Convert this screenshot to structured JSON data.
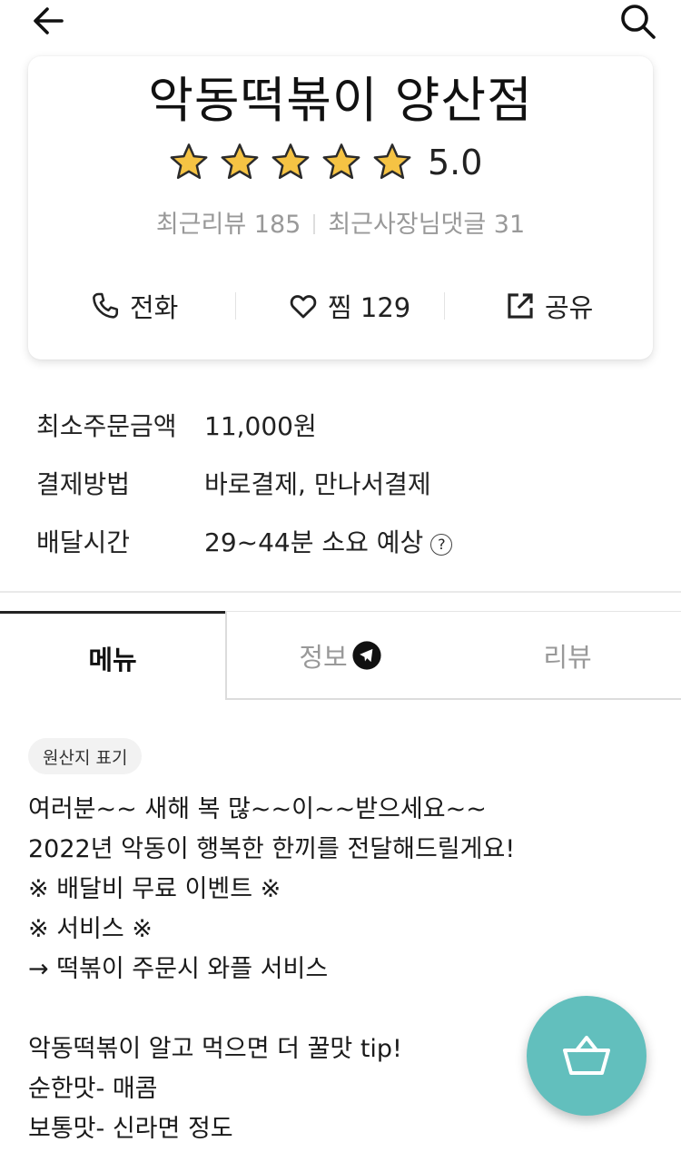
{
  "header": {
    "back_icon": "arrow-left-icon",
    "search_icon": "search-icon"
  },
  "store": {
    "name": "악동떡볶이 양산점",
    "rating": "5.0",
    "stars_filled": 5,
    "stars_total": 5,
    "star_color": "#f5c344",
    "recent_reviews_label": "최근리뷰 185",
    "recent_owner_replies_label": "최근사장님댓글 31"
  },
  "actions": {
    "call": {
      "label": "전화",
      "icon": "phone-icon"
    },
    "like": {
      "label": "찜 129",
      "icon": "heart-icon"
    },
    "share": {
      "label": "공유",
      "icon": "share-icon"
    }
  },
  "info": {
    "rows": [
      {
        "label": "최소주문금액",
        "value": "11,000원"
      },
      {
        "label": "결제방법",
        "value": "바로결제, 만나서결제"
      },
      {
        "label": "배달시간",
        "value": "29~44분 소요 예상"
      }
    ],
    "help_icon_text": "?"
  },
  "tabs": [
    {
      "label": "메뉴",
      "active": true
    },
    {
      "label": "정보",
      "active": false,
      "badge_icon": "megaphone-icon"
    },
    {
      "label": "리뷰",
      "active": false
    }
  ],
  "origin_button": "원산지 표기",
  "notice_lines": [
    "여러분~~ 새해 복 많~~이~~받으세요~~",
    "2022년 악동이 행복한 한끼를 전달해드릴게요!",
    "※ 배달비 무료 이벤트 ※",
    "※ 서비스 ※",
    "→ 떡볶이 주문시 와플 서비스",
    "",
    "악동떡볶이 알고 먹으면 더 꿀맛 tip!",
    "순한맛- 매콤",
    "보통맛- 신라면 정도"
  ],
  "cart": {
    "icon": "basket-icon",
    "color": "#62bfbd"
  }
}
